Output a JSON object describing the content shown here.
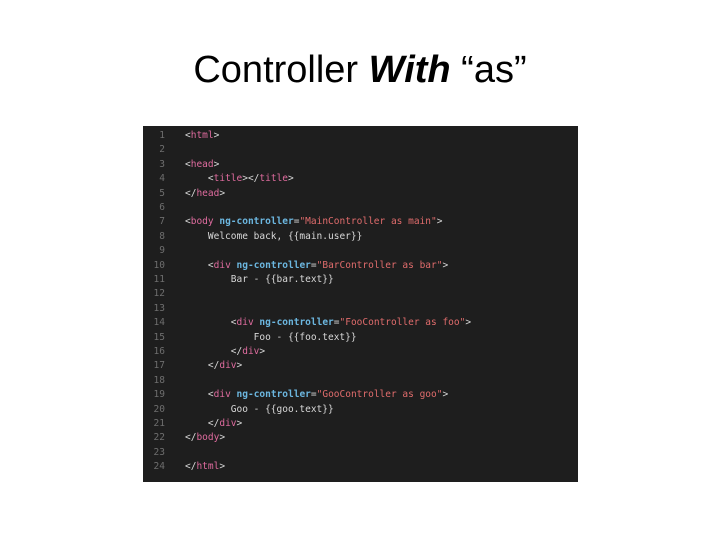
{
  "slide": {
    "title_part1": "Controller ",
    "title_emph": "With",
    "title_part2": " “as”"
  },
  "code": {
    "lines": [
      {
        "n": "1",
        "indent": "",
        "tokens": [
          {
            "t": "<",
            "c": "punc"
          },
          {
            "t": "html",
            "c": "tag"
          },
          {
            "t": ">",
            "c": "punc"
          }
        ]
      },
      {
        "n": "2",
        "indent": "",
        "tokens": []
      },
      {
        "n": "3",
        "indent": "",
        "tokens": [
          {
            "t": "<",
            "c": "punc"
          },
          {
            "t": "head",
            "c": "tag"
          },
          {
            "t": ">",
            "c": "punc"
          }
        ]
      },
      {
        "n": "4",
        "indent": "    ",
        "tokens": [
          {
            "t": "<",
            "c": "punc"
          },
          {
            "t": "title",
            "c": "tag"
          },
          {
            "t": "></",
            "c": "punc"
          },
          {
            "t": "title",
            "c": "tag"
          },
          {
            "t": ">",
            "c": "punc"
          }
        ]
      },
      {
        "n": "5",
        "indent": "",
        "tokens": [
          {
            "t": "</",
            "c": "punc"
          },
          {
            "t": "head",
            "c": "tag"
          },
          {
            "t": ">",
            "c": "punc"
          }
        ]
      },
      {
        "n": "6",
        "indent": "",
        "tokens": []
      },
      {
        "n": "7",
        "indent": "",
        "tokens": [
          {
            "t": "<",
            "c": "punc"
          },
          {
            "t": "body",
            "c": "tag"
          },
          {
            "t": " ",
            "c": "txt"
          },
          {
            "t": "ng-controller",
            "c": "attr"
          },
          {
            "t": "=",
            "c": "punc"
          },
          {
            "t": "\"MainController as main\"",
            "c": "str"
          },
          {
            "t": ">",
            "c": "punc"
          }
        ]
      },
      {
        "n": "8",
        "indent": "    ",
        "tokens": [
          {
            "t": "Welcome back, {{main.user}}",
            "c": "txt"
          }
        ]
      },
      {
        "n": "9",
        "indent": "",
        "tokens": []
      },
      {
        "n": "10",
        "indent": "    ",
        "tokens": [
          {
            "t": "<",
            "c": "punc"
          },
          {
            "t": "div",
            "c": "tag"
          },
          {
            "t": " ",
            "c": "txt"
          },
          {
            "t": "ng-controller",
            "c": "attr"
          },
          {
            "t": "=",
            "c": "punc"
          },
          {
            "t": "\"BarController as bar\"",
            "c": "str"
          },
          {
            "t": ">",
            "c": "punc"
          }
        ]
      },
      {
        "n": "11",
        "indent": "        ",
        "tokens": [
          {
            "t": "Bar - {{bar.text}}",
            "c": "txt"
          }
        ]
      },
      {
        "n": "12",
        "indent": "",
        "tokens": []
      },
      {
        "n": "13",
        "indent": "",
        "tokens": []
      },
      {
        "n": "14",
        "indent": "        ",
        "tokens": [
          {
            "t": "<",
            "c": "punc"
          },
          {
            "t": "div",
            "c": "tag"
          },
          {
            "t": " ",
            "c": "txt"
          },
          {
            "t": "ng-controller",
            "c": "attr"
          },
          {
            "t": "=",
            "c": "punc"
          },
          {
            "t": "\"FooController as foo\"",
            "c": "str"
          },
          {
            "t": ">",
            "c": "punc"
          }
        ]
      },
      {
        "n": "15",
        "indent": "            ",
        "tokens": [
          {
            "t": "Foo - {{foo.text}}",
            "c": "txt"
          }
        ]
      },
      {
        "n": "16",
        "indent": "        ",
        "tokens": [
          {
            "t": "</",
            "c": "punc"
          },
          {
            "t": "div",
            "c": "tag"
          },
          {
            "t": ">",
            "c": "punc"
          }
        ]
      },
      {
        "n": "17",
        "indent": "    ",
        "tokens": [
          {
            "t": "</",
            "c": "punc"
          },
          {
            "t": "div",
            "c": "tag"
          },
          {
            "t": ">",
            "c": "punc"
          }
        ]
      },
      {
        "n": "18",
        "indent": "",
        "tokens": []
      },
      {
        "n": "19",
        "indent": "    ",
        "tokens": [
          {
            "t": "<",
            "c": "punc"
          },
          {
            "t": "div",
            "c": "tag"
          },
          {
            "t": " ",
            "c": "txt"
          },
          {
            "t": "ng-controller",
            "c": "attr"
          },
          {
            "t": "=",
            "c": "punc"
          },
          {
            "t": "\"GooController as goo\"",
            "c": "str"
          },
          {
            "t": ">",
            "c": "punc"
          }
        ]
      },
      {
        "n": "20",
        "indent": "        ",
        "tokens": [
          {
            "t": "Goo - {{goo.text}}",
            "c": "txt"
          }
        ]
      },
      {
        "n": "21",
        "indent": "    ",
        "tokens": [
          {
            "t": "</",
            "c": "punc"
          },
          {
            "t": "div",
            "c": "tag"
          },
          {
            "t": ">",
            "c": "punc"
          }
        ]
      },
      {
        "n": "22",
        "indent": "",
        "tokens": [
          {
            "t": "</",
            "c": "punc"
          },
          {
            "t": "body",
            "c": "tag"
          },
          {
            "t": ">",
            "c": "punc"
          }
        ]
      },
      {
        "n": "23",
        "indent": "",
        "tokens": []
      },
      {
        "n": "24",
        "indent": "",
        "tokens": [
          {
            "t": "</",
            "c": "punc"
          },
          {
            "t": "html",
            "c": "tag"
          },
          {
            "t": ">",
            "c": "punc"
          }
        ]
      }
    ]
  }
}
